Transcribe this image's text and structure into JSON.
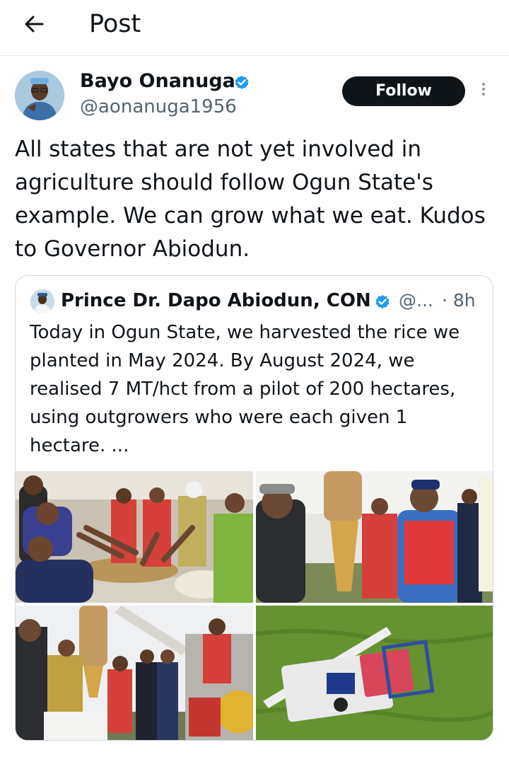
{
  "header": {
    "title": "Post"
  },
  "post": {
    "author_name": "Bayo Onanuga",
    "author_handle": "@aonanuga1956",
    "follow_label": "Follow",
    "text": "All states that are not yet involved in agriculture should follow Ogun State's example. We can grow what we eat. Kudos to Governor Abiodun."
  },
  "quote": {
    "author_name": "Prince Dr. Dapo Abiodun, CON",
    "author_handle": "@...",
    "time": "· 8h",
    "text": "Today in Ogun State, we harvested the rice we planted in May 2024. By August 2024, we realised 7 MT/hct from a pilot of 200 hectares, using outgrowers who were each given 1 hectare. ..."
  },
  "icons": {
    "back": "arrow-left-icon",
    "verified": "verified-badge-icon",
    "more": "more-vertical-icon"
  },
  "colors": {
    "verified_blue": "#1d9bf0",
    "follow_bg": "#0f1419",
    "secondary_text": "#536471",
    "border": "#cfd9de"
  }
}
